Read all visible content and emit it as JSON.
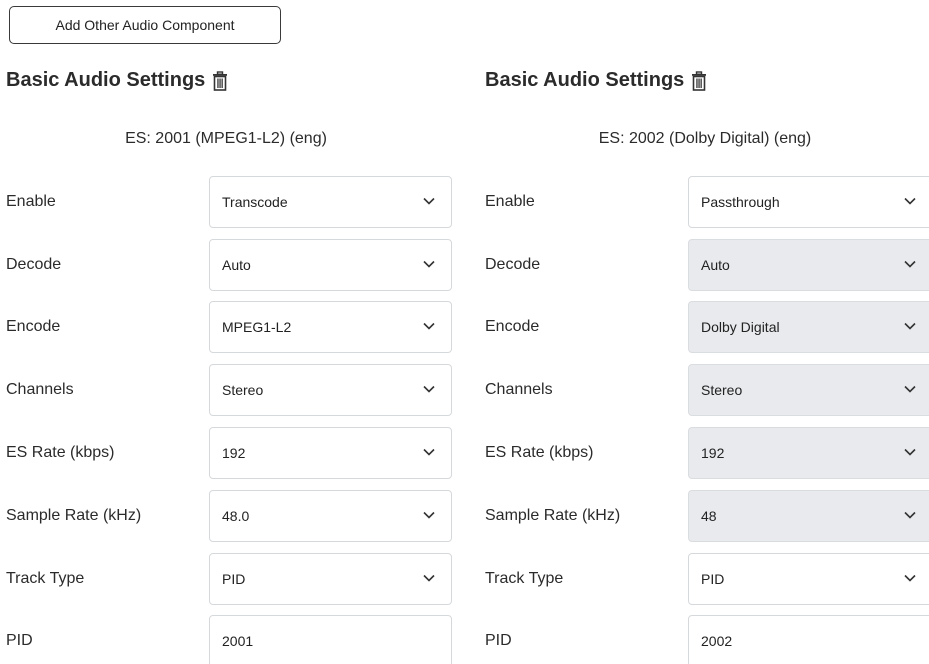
{
  "toolbar": {
    "add_button_label": "Add Other Audio Component"
  },
  "panels": [
    {
      "title": "Basic Audio Settings",
      "es_label": "ES: 2001 (MPEG1-L2) (eng)",
      "fields": [
        {
          "label": "Enable",
          "value": "Transcode",
          "type": "select",
          "disabled": false
        },
        {
          "label": "Decode",
          "value": "Auto",
          "type": "select",
          "disabled": false
        },
        {
          "label": "Encode",
          "value": "MPEG1-L2",
          "type": "select",
          "disabled": false
        },
        {
          "label": "Channels",
          "value": "Stereo",
          "type": "select",
          "disabled": false
        },
        {
          "label": "ES Rate (kbps)",
          "value": "192",
          "type": "select",
          "disabled": false
        },
        {
          "label": "Sample Rate (kHz)",
          "value": "48.0",
          "type": "select",
          "disabled": false
        },
        {
          "label": "Track Type",
          "value": "PID",
          "type": "select",
          "disabled": false
        },
        {
          "label": "PID",
          "value": "2001",
          "type": "input",
          "disabled": false
        }
      ]
    },
    {
      "title": "Basic Audio Settings",
      "es_label": "ES: 2002 (Dolby Digital) (eng)",
      "fields": [
        {
          "label": "Enable",
          "value": "Passthrough",
          "type": "select",
          "disabled": false
        },
        {
          "label": "Decode",
          "value": "Auto",
          "type": "select",
          "disabled": true
        },
        {
          "label": "Encode",
          "value": "Dolby Digital",
          "type": "select",
          "disabled": true
        },
        {
          "label": "Channels",
          "value": "Stereo",
          "type": "select",
          "disabled": true
        },
        {
          "label": "ES Rate (kbps)",
          "value": "192",
          "type": "select",
          "disabled": true
        },
        {
          "label": "Sample Rate (kHz)",
          "value": "48",
          "type": "select",
          "disabled": true
        },
        {
          "label": "Track Type",
          "value": "PID",
          "type": "select",
          "disabled": false
        },
        {
          "label": "PID",
          "value": "2002",
          "type": "input",
          "disabled": false
        }
      ]
    }
  ],
  "icons": {
    "delete": "trash-icon",
    "dropdown": "chevron-down-icon"
  },
  "colors": {
    "disabled_field_bg": "#e8eaed",
    "field_border": "#d6d9dc",
    "text": "#222222"
  }
}
